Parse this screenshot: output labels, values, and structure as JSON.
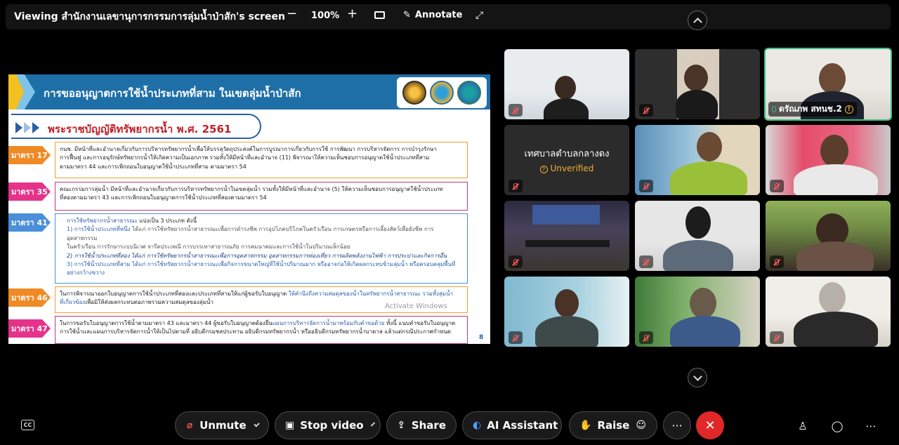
{
  "share_bar": {
    "title": "Viewing สำนักงานเลขานุการกรรมการลุ่มน้ำป่าสัก's screen",
    "zoom_minus": "−",
    "zoom_level": "100%",
    "zoom_plus": "+",
    "annotate_label": "Annotate"
  },
  "slide": {
    "title": "การขออนุญาตการใช้น้ำประเภทที่สาม ในเขตลุ่มน้ำป่าสัก",
    "act_title": "พระราชบัญญัติทรัพยากรน้ำ พ.ศ. 2561",
    "sections": [
      {
        "tag": "มาตรา 17",
        "lines": [
          "กนช. มีหน้าที่และอำนาจเกี่ยวกับการบริหารทรัพยากรน้ำเพื่อให้บรรลุวัตถุประสงค์ในการบูรณาการเกี่ยวกับการใช้ การพัฒนา การบริหารจัดการ การบำรุงรักษา",
          "การฟื้นฟู และการอนุรักษ์ทรัพยากรน้ำให้เกิดความเป็นเอกภาพ รวมทั้งให้มีหน้าที่และอำนาจ (11) พิจารณาให้ความเห็นชอบการอนุญาตใช้น้ำประเภทที่สาม",
          "ตามมาตรา 44 และการเพิกถอนใบอนุญาตใช้น้ำประเภทที่สาม ตามมาตรา 54"
        ]
      },
      {
        "tag": "มาตรา 35",
        "lines": [
          "คณะกรรมการลุ่มน้ำ มีหน้าที่และอำนาจเกี่ยวกับการบริหารทรัพยากรน้ำในเขตลุ่มน้ำ รวมทั้งให้มีหน้าที่และอำนาจ (5) ให้ความเห็นชอบการอนุญาตใช้น้ำประเภท",
          "ที่สองตามมาตรา 43 และการเพิกถอนใบอนุญาตการใช้น้ำประเภทที่สองตามมาตรา 54"
        ]
      },
      {
        "tag": "มาตรา 41",
        "heading_a": "การใช้ทรัพยากรน้ำสาธารณะ",
        "heading_b": " แบ่งเป็น 3 ประเภท ดังนี้",
        "item1_a": "1) การใช้น้ำประเภทที่หนึ่ง ",
        "item1_b": "ได้แก่ การใช้ทรัพยากรน้ำสาธารณะเพื่อการดำรงชีพ การอุปโภคบริโภคในครัวเรือน การเกษตรหรือการเลี้ยงสัตว์เพื่อยังชีพ การอุตสาหกรรม",
        "item1_c": "ในครัวเรือน การรักษาระบบนิเวศ จารีตประเพณี การบรรเทาสาธารณภัย การคมนาคมและการใช้น้ำในปริมาณเล็กน้อย",
        "item2": "2) การใช้น้ำประเภทที่สอง ได้แก่ การใช้ทรัพยากรน้ำสาธารณะเพื่อการอุตสาหกรรม อุตสาหกรรมการท่องเที่ยว การผลิตพลังงานไฟฟ้า การประปาและกิจการอื่น",
        "item3_a": "3) การใช้น้ำประเภทที่สาม ",
        "item3_b": "ได้แก่ การใช้ทรัพยากรน้ำสาธารณะเพื่อกิจการขนาดใหญ่ที่ใช้น้ำปริมาณมาก หรืออาจก่อให้เกิดผลกระทบข้ามลุ่มน้ำ หรือครอบคลุมพื้นที่",
        "item3_c": "อย่างกว้างขวาง"
      },
      {
        "tag": "มาตรา 46",
        "line_a": "ในการพิจารณาออกใบอนุญาตการใช้น้ำประเภทที่สองและประเภทที่สามให้แก่ผู้ขอรับใบอนุญาต ",
        "line_b": "ให้คำนึงถึงความสมดุลของน้ำในทรัพยากรน้ำสาธารณะ รวมทั้งลุ่มน้ำ",
        "line_c": "ที่เกี่ยวข้อง",
        "line_d": "เพื่อมิให้ส่งผลกระทบต่อภาพรวมความสมดุลของลุ่มน้ำ"
      },
      {
        "tag": "มาตรา 47",
        "line_a": "ในการขอรับใบอนุญาตการใช้น้ำตามมาตรา 43 และมาตรา 44 ผู้ขอรับใบอนุญาตต้องยื่น",
        "line_b": "แผนการบริหารจัดการน้ำมาพร้อมกับคำขอด้วย",
        "line_c": " ทั้งนี้ แนบคำขอรับใบอนุญาต",
        "line_d": "การใช้น้ำและแผนการบริหารจัดการน้ำให้เป็นไปตามที่ อธิบดีกรมชลประทาน อธิบดีกรมทรัพยากรน้ำ หรืออธิบดีกรมทรัพยากรน้ำบาดาล แล้วแต่กรณีประกาศกำหนด"
      }
    ],
    "watermark": "Activate Windows",
    "page_number": "8"
  },
  "participants": [
    {
      "name": "",
      "status": "muted"
    },
    {
      "name": "",
      "status": "muted"
    },
    {
      "name": "ดรัณภพ สทนช.2",
      "status": "live",
      "active": true
    },
    {
      "name": "เทศบาลตำบลกลางดง",
      "badge": "Unverified",
      "status": "muted"
    },
    {
      "name": "",
      "status": "muted"
    },
    {
      "name": "",
      "status": "muted"
    },
    {
      "name": "",
      "status": "muted"
    },
    {
      "name": "",
      "status": "muted"
    },
    {
      "name": "",
      "status": "muted"
    },
    {
      "name": "",
      "status": "muted"
    },
    {
      "name": "",
      "status": "muted"
    },
    {
      "name": "",
      "status": "muted"
    }
  ],
  "toolbar": {
    "unmute": "Unmute",
    "stop_video": "Stop video",
    "share": "Share",
    "ai_assistant": "AI Assistant",
    "raise": "Raise",
    "more": "···",
    "leave": "✕",
    "cc": "CC"
  },
  "icons": {
    "leave_color": "#e02828",
    "active_border": "#3fbf8a",
    "muted_color": "#ff5a5a",
    "cohost_color": "#f0b030"
  }
}
